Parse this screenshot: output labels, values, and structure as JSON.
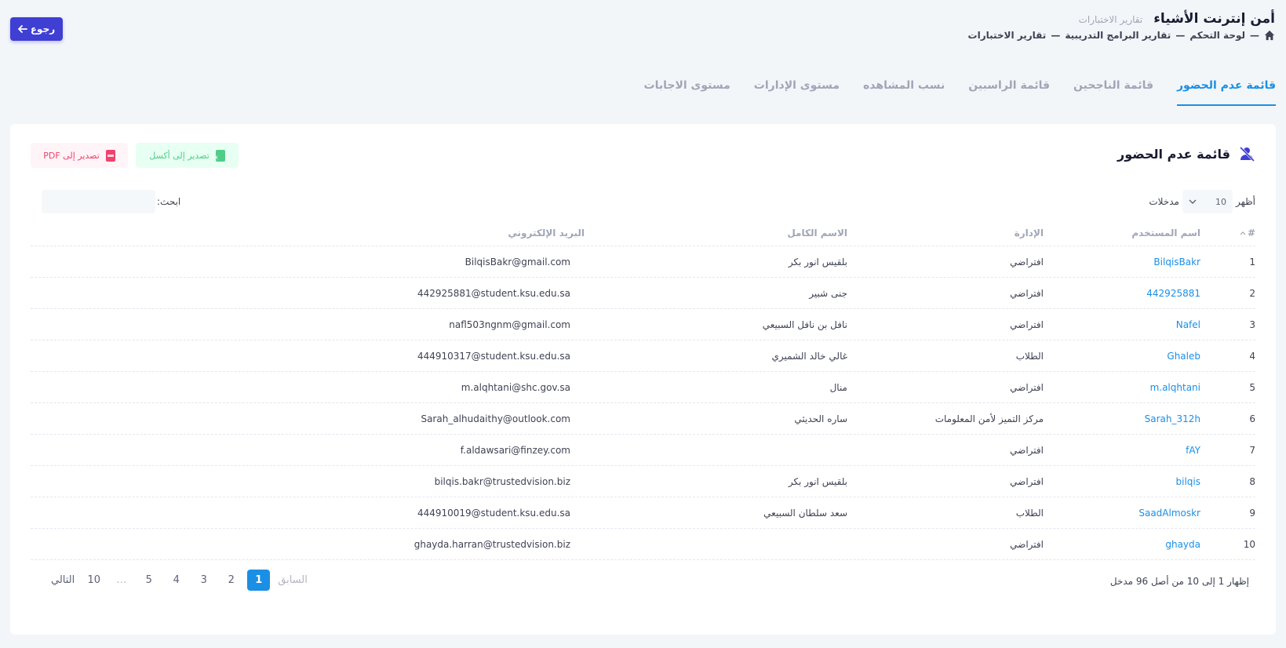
{
  "header": {
    "title": "أمن إنترنت الأشياء",
    "subtitle": "تقارير الاختبارات",
    "breadcrumb": [
      "لوحة التحكم",
      "تقارير البرامج التدريبية",
      "تقارير الاختبارات"
    ],
    "back_label": "رجوع"
  },
  "tabs": [
    {
      "label": "قائمة عدم الحضور",
      "active": true
    },
    {
      "label": "قائمة الناجحين",
      "active": false
    },
    {
      "label": "قائمة الراسبين",
      "active": false
    },
    {
      "label": "نسب المشاهده",
      "active": false
    },
    {
      "label": "مستوى الإدارات",
      "active": false
    },
    {
      "label": "مستوى الاجابات",
      "active": false
    }
  ],
  "card": {
    "title": "قائمة عدم الحضور",
    "export_excel": "تصدير إلى أكسل",
    "export_pdf": "تصدير إلى PDF",
    "show_label": "أظهر",
    "entries_label": "مدخلات",
    "page_size": "10",
    "search_label": "ابحث:"
  },
  "table": {
    "headers": {
      "num": "#",
      "username": "اسم المستخدم",
      "department": "الإدارة",
      "fullname": "الاسم الكامل",
      "email": "البريد الإلكتروني"
    },
    "rows": [
      {
        "num": "1",
        "username": "BilqisBakr",
        "department": "افتراضي",
        "fullname": "بلقيس انور بكر",
        "email": "BilqisBakr@gmail.com"
      },
      {
        "num": "2",
        "username": "442925881",
        "department": "افتراضي",
        "fullname": "جنى شبير",
        "email": "442925881@student.ksu.edu.sa"
      },
      {
        "num": "3",
        "username": "Nafel",
        "department": "افتراضي",
        "fullname": "نافل بن نافل السبيعي",
        "email": "nafl503ngnm@gmail.com"
      },
      {
        "num": "4",
        "username": "Ghaleb",
        "department": "الطلاب",
        "fullname": "غالي خالد الشميري",
        "email": "444910317@student.ksu.edu.sa"
      },
      {
        "num": "5",
        "username": "m.alqhtani",
        "department": "افتراضي",
        "fullname": "منال",
        "email": "m.alqhtani@shc.gov.sa"
      },
      {
        "num": "6",
        "username": "Sarah_312h",
        "department": "مركز التميز لأمن المعلومات",
        "fullname": "ساره الحديثي",
        "email": "Sarah_alhudaithy@outlook.com"
      },
      {
        "num": "7",
        "username": "fAY",
        "department": "افتراضي",
        "fullname": "",
        "email": "f.aldawsari@finzey.com"
      },
      {
        "num": "8",
        "username": "bilqis",
        "department": "افتراضي",
        "fullname": "بلقيس انور بكر",
        "email": "bilqis.bakr@trustedvision.biz"
      },
      {
        "num": "9",
        "username": "SaadAlmoskr",
        "department": "الطلاب",
        "fullname": "سعد سلطان السبيعي",
        "email": "444910019@student.ksu.edu.sa"
      },
      {
        "num": "10",
        "username": "ghayda",
        "department": "افتراضي",
        "fullname": "",
        "email": "ghayda.harran@trustedvision.biz"
      }
    ]
  },
  "footer": {
    "info": "إظهار 1 إلى 10 من أصل 96 مدخل",
    "prev": "السابق",
    "next": "التالي",
    "pages": [
      "1",
      "2",
      "3",
      "4",
      "5",
      "…",
      "10"
    ],
    "current_page": "1"
  },
  "colors": {
    "primary": "#3f3fd4",
    "accent": "#1b8fe5",
    "excel": "#50cd89",
    "pdf": "#f1416c"
  }
}
